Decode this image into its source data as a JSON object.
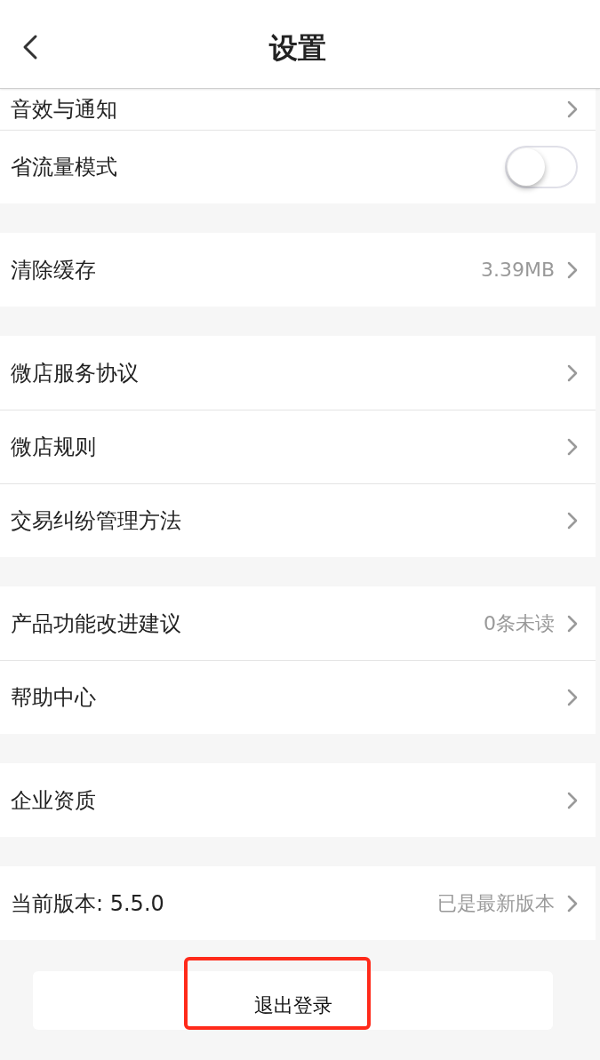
{
  "header": {
    "title": "设置"
  },
  "groups": [
    {
      "rows": [
        {
          "kind": "link",
          "label": "音效与通知"
        },
        {
          "kind": "toggle",
          "label": "省流量模式",
          "on": false
        }
      ]
    },
    {
      "rows": [
        {
          "kind": "link",
          "label": "清除缓存",
          "value": "3.39MB"
        }
      ]
    },
    {
      "rows": [
        {
          "kind": "link",
          "label": "微店服务协议"
        },
        {
          "kind": "link",
          "label": "微店规则"
        },
        {
          "kind": "link",
          "label": "交易纠纷管理方法"
        }
      ]
    },
    {
      "rows": [
        {
          "kind": "link",
          "label": "产品功能改进建议",
          "value": "0条未读"
        },
        {
          "kind": "link",
          "label": "帮助中心"
        }
      ]
    },
    {
      "rows": [
        {
          "kind": "link",
          "label": "企业资质"
        }
      ]
    },
    {
      "rows": [
        {
          "kind": "link",
          "label": "当前版本: 5.5.0",
          "value": "已是最新版本"
        }
      ]
    }
  ],
  "logout_button": {
    "label": "退出登录",
    "highlighted": true
  }
}
